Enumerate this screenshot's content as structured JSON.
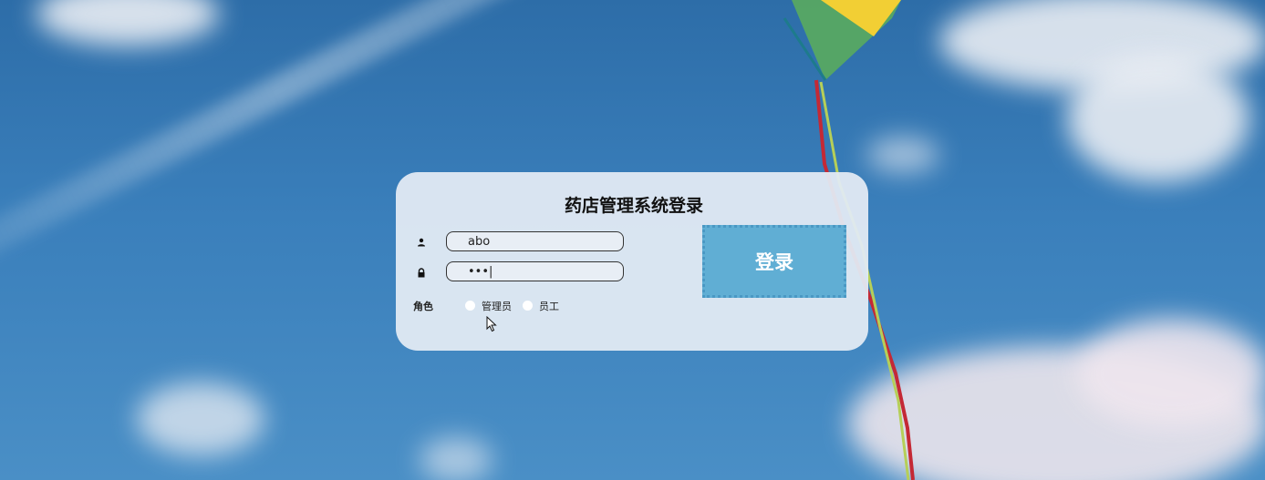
{
  "background": {
    "sky_color": "#3a7fbb",
    "image_description": "blue sky, contrail, kite with ribbon tail"
  },
  "login": {
    "title": "药店管理系统登录",
    "username": {
      "icon": "user-icon",
      "value": "abo"
    },
    "password": {
      "icon": "lock-icon",
      "value": "•••|"
    },
    "role": {
      "label": "角色",
      "options": [
        {
          "label": "管理员",
          "selected": false
        },
        {
          "label": "员工",
          "selected": false
        }
      ]
    },
    "submit_label": "登录"
  },
  "colors": {
    "button": "#60aed4",
    "card": "#e2eaf3"
  }
}
